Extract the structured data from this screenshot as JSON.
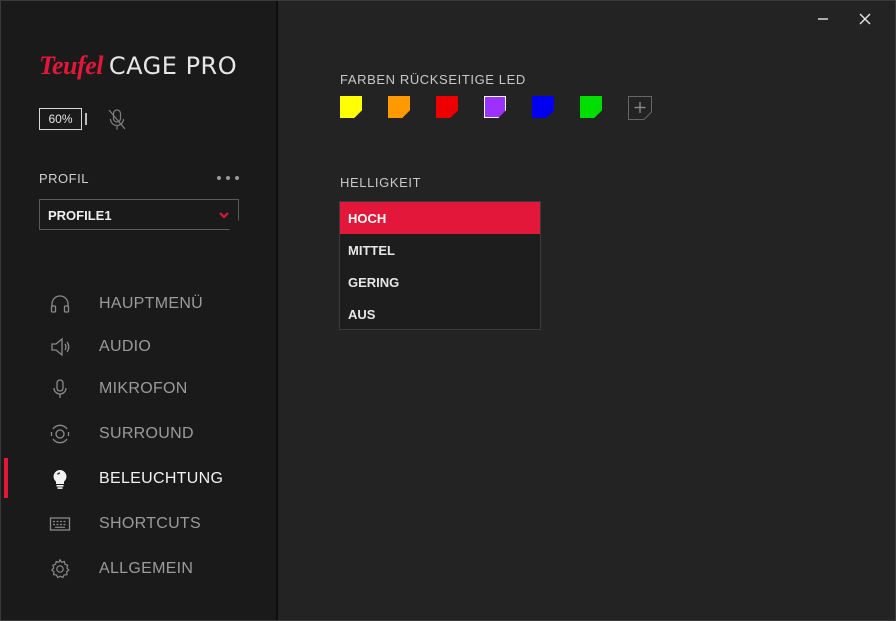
{
  "brand": {
    "teufel": "Teufel",
    "product": "CAGE PRO"
  },
  "status": {
    "battery": "60%"
  },
  "profile": {
    "label": "PROFIL",
    "selected": "PROFILE1"
  },
  "nav": [
    {
      "label": "HAUPTMENÜ",
      "icon": "headphones-icon",
      "active": false
    },
    {
      "label": "AUDIO",
      "icon": "speaker-icon",
      "active": false
    },
    {
      "label": "MIKROFON",
      "icon": "microphone-icon",
      "active": false
    },
    {
      "label": "SURROUND",
      "icon": "surround-icon",
      "active": false
    },
    {
      "label": "BELEUCHTUNG",
      "icon": "lightbulb-icon",
      "active": true
    },
    {
      "label": "SHORTCUTS",
      "icon": "keyboard-icon",
      "active": false
    },
    {
      "label": "ALLGEMEIN",
      "icon": "gear-icon",
      "active": false
    }
  ],
  "lighting": {
    "colors_title": "FARBEN RÜCKSEITIGE LED",
    "colors": [
      "#ffff00",
      "#ff9900",
      "#ee0000",
      "#9b30ff",
      "#0000ee",
      "#00dd00"
    ],
    "brightness_title": "HELLIGKEIT",
    "brightness_options": [
      "HOCH",
      "MITTEL",
      "GERING",
      "AUS"
    ],
    "brightness_selected": "HOCH"
  },
  "theme": {
    "accent": "#e3173a"
  }
}
